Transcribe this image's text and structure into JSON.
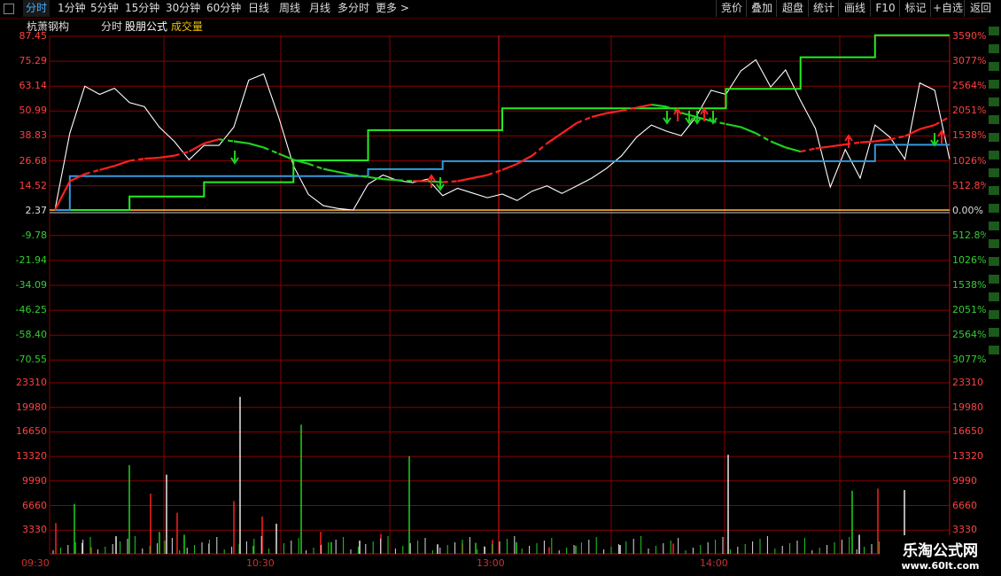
{
  "toolbar": {
    "periods": [
      "分时",
      "1分钟",
      "5分钟",
      "15分钟",
      "30分钟",
      "60分钟",
      "日线",
      "周线",
      "月线",
      "多分时",
      "更多 >"
    ],
    "active_period": "分时",
    "right_buttons": [
      "竞价",
      "叠加",
      "超盘",
      "统计",
      "画线",
      "F10",
      "标记",
      "+自选",
      "返回"
    ]
  },
  "header": {
    "stock_name": "杭萧钢构",
    "mode": "分时",
    "formula": "股朋公式",
    "indicator": "成交量"
  },
  "price_axis": {
    "left_labels": [
      "87.45",
      "75.29",
      "63.14",
      "50.99",
      "38.83",
      "26.68",
      "14.52",
      "2.37",
      "-9.78",
      "-21.94",
      "-34.09",
      "-46.25",
      "-58.40",
      "-70.55"
    ],
    "right_labels": [
      "3590%",
      "3077%",
      "2564%",
      "2051%",
      "1538%",
      "1026%",
      "512.8%",
      "0.00%",
      "512.8%",
      "1026%",
      "1538%",
      "2051%",
      "2564%",
      "3077%"
    ]
  },
  "volume_axis": {
    "labels": [
      "23310",
      "19980",
      "16650",
      "13320",
      "9990",
      "6660",
      "3330"
    ]
  },
  "time_axis": {
    "labels": [
      "09:30",
      "10:30",
      "13:00",
      "14:00"
    ]
  },
  "watermark": {
    "title": "乐淘公式网",
    "url": "www.60lt.com"
  },
  "colors": {
    "up": "#ff2020",
    "down": "#20d020",
    "grid": "#8b0000",
    "price_line": "#ffffff",
    "step_green": "#22ee22",
    "step_blue": "#3399dd",
    "baseline": "#ffee55",
    "formula_label": "#ffffff",
    "indicator_label": "#f0c000"
  },
  "chart_data": [
    {
      "type": "line",
      "name": "intraday-price",
      "x": [
        0,
        4,
        8,
        12,
        16,
        20,
        24,
        28,
        32,
        36,
        40,
        44,
        48,
        52,
        56,
        60,
        64,
        68,
        72,
        76,
        80,
        84,
        88,
        92,
        96,
        100,
        104,
        108,
        112,
        116,
        120,
        124,
        128,
        132,
        136,
        140,
        144,
        148,
        152,
        156,
        160,
        164,
        168,
        172,
        176,
        180,
        184,
        188,
        192,
        196,
        200,
        204,
        208,
        212,
        216,
        220,
        224,
        228,
        232,
        236,
        240
      ],
      "white": [
        2.37,
        40,
        63,
        59,
        62,
        55,
        53,
        43,
        36,
        27,
        34,
        34,
        43,
        66,
        69,
        48,
        24,
        10,
        4.5,
        3.1,
        2.37,
        15,
        19.5,
        16.8,
        15.8,
        17.5,
        9.4,
        13,
        10.7,
        8.4,
        10.2,
        7,
        11.6,
        14.2,
        10.5,
        14.2,
        18,
        22.8,
        29,
        38,
        44,
        41,
        38.8,
        48,
        61,
        59,
        70.5,
        76,
        62.6,
        71,
        56,
        42.3,
        13.6,
        32,
        18,
        44,
        38,
        27.3,
        64.6,
        61,
        27.3
      ],
      "red_ma": [
        2.37,
        16.5,
        20,
        22,
        24,
        26.5,
        27.5,
        28,
        29,
        31,
        35,
        37,
        36,
        35,
        33,
        30,
        27,
        25,
        22.5,
        21,
        19.5,
        18.5,
        17.5,
        17,
        16.5,
        16.5,
        16,
        16.5,
        18,
        19.5,
        22,
        25,
        29,
        35,
        40,
        45,
        48,
        49.8,
        51,
        52.5,
        54,
        53,
        50,
        48,
        46,
        44.5,
        43,
        40,
        36,
        33,
        31,
        32.5,
        33.5,
        34.5,
        35.5,
        36,
        37,
        38.5,
        42,
        44,
        48
      ]
    },
    {
      "type": "line",
      "name": "green-step",
      "x": [
        0,
        4,
        20,
        40,
        64,
        84,
        120,
        180,
        200,
        220,
        240
      ],
      "values": [
        2.37,
        2.37,
        9,
        16,
        26.7,
        41.5,
        52.2,
        61.7,
        77.2,
        88,
        88
      ]
    },
    {
      "type": "line",
      "name": "blue-step",
      "x": [
        0,
        4,
        20,
        64,
        84,
        104,
        180,
        200,
        220,
        240
      ],
      "values": [
        2.37,
        19,
        19,
        19,
        22.4,
        26.3,
        26.3,
        26.3,
        34.3,
        34.3
      ]
    },
    {
      "type": "bar",
      "name": "volume",
      "categories": [
        "09:30",
        "10:30",
        "13:00",
        "14:00"
      ],
      "values": [
        4200,
        6800,
        1500,
        900,
        12100,
        2400,
        8200,
        3000,
        10800,
        5600,
        2600,
        1400,
        7200,
        1100,
        21400,
        5100,
        17600,
        4100,
        3000,
        1600,
        1800,
        2700,
        13300,
        1300,
        1400,
        1500,
        1000,
        1900,
        1600,
        13500,
        900,
        1100,
        1200,
        1400,
        8600,
        2600,
        8900,
        1600,
        8700
      ]
    }
  ]
}
